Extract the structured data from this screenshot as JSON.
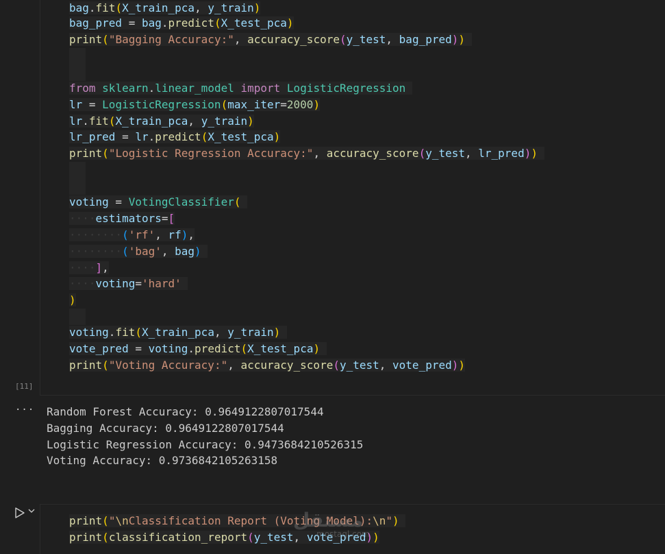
{
  "cell1": {
    "execution_count": "[11]",
    "lines": [
      "bag.fit(X_train_pca, y_train)",
      "bag_pred = bag.predict(X_test_pca)",
      "print(\"Bagging Accuracy:\", accuracy_score(y_test, bag_pred))",
      "from sklearn.linear_model import LogisticRegression",
      "lr = LogisticRegression(max_iter=2000)",
      "lr.fit(X_train_pca, y_train)",
      "lr_pred = lr.predict(X_test_pca)",
      "print(\"Logistic Regression Accuracy:\", accuracy_score(y_test, lr_pred))",
      "voting = VotingClassifier(",
      "    estimators=[",
      "        ('rf', rf),",
      "        ('bag', bag)",
      "    ],",
      "    voting='hard'",
      ")",
      "voting.fit(X_train_pca, y_train)",
      "vote_pred = voting.predict(X_test_pca)",
      "print(\"Voting Accuracy:\", accuracy_score(y_test, vote_pred))"
    ]
  },
  "output": {
    "more_label": "···",
    "lines": [
      "Random Forest Accuracy: 0.9649122807017544",
      "Bagging Accuracy: 0.9649122807017544",
      "Logistic Regression Accuracy: 0.9473684210526315",
      "Voting Accuracy: 0.9736842105263158"
    ]
  },
  "cell2": {
    "lines": [
      "print(\"\\nClassification Report (Voting Model):\\n\")",
      "print(classification_report(y_test, vote_pred))"
    ]
  },
  "watermark": {
    "text": "مستقل",
    "subtext": "mostaql.com"
  },
  "colors": {
    "background": "#1f1f1f",
    "keyword": "#c586c0",
    "variable": "#9cdcfe",
    "function": "#dcdcaa",
    "class": "#4ec9b0",
    "string": "#ce9178",
    "number": "#b5cea8"
  }
}
